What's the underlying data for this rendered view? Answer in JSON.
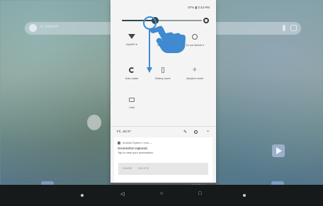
{
  "status_bar": {
    "text": "97% ▮ 3:44 PM"
  },
  "brightness": {
    "level": 0.42
  },
  "quick_tiles": [
    {
      "icon": "wifi-icon",
      "label": "MyWiFi ▾"
    },
    {
      "icon": "bluetooth-icon",
      "label": "Bluetooth"
    },
    {
      "icon": "do-not-disturb-icon",
      "label": "Do not disturb ▾"
    },
    {
      "icon": "auto-rotate-icon",
      "label": "Auto-rotate"
    },
    {
      "icon": "battery-saver-icon",
      "label": "Battery saver"
    },
    {
      "icon": "airplane-mode-icon",
      "label": "Airplane mode"
    },
    {
      "icon": "cast-icon",
      "label": "Cast"
    }
  ],
  "shade": {
    "date": "Fri, Jul 27"
  },
  "notification": {
    "app": "Android System • now ⌄",
    "title": "Screenshot captured.",
    "subtitle": "Tap to view your screenshot.",
    "actions": [
      "SHARE",
      "DELETE"
    ]
  },
  "clear_all": "CLEAR ALL",
  "home": {
    "search_hint": "G Search"
  },
  "accent": "#3f8ad0"
}
